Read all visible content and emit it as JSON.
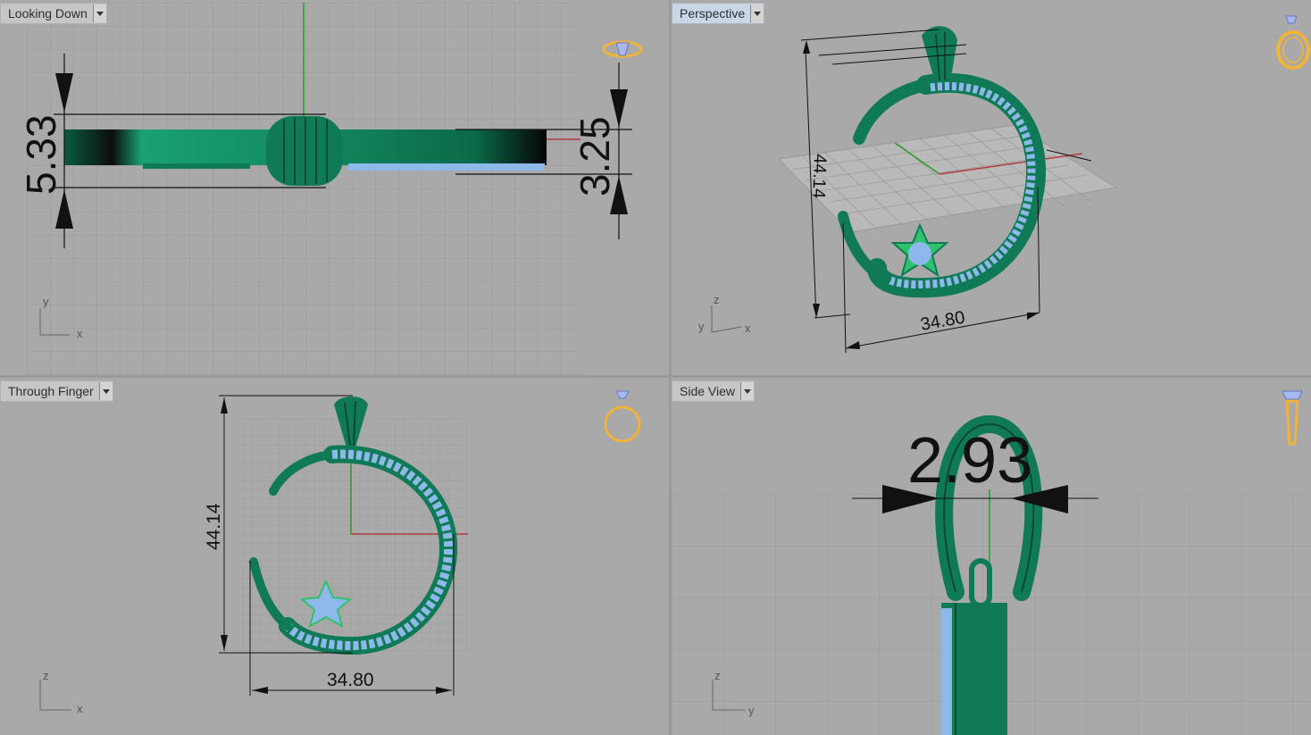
{
  "viewports": {
    "top_left": {
      "title": "Looking Down",
      "dims": [
        "5.33",
        "3.25"
      ],
      "axes": [
        "y",
        "x"
      ]
    },
    "top_right": {
      "title": "Perspective",
      "dims": [
        "44.14",
        "34.80"
      ],
      "axes": [
        "z",
        "y",
        "x"
      ]
    },
    "bottom_left": {
      "title": "Through Finger",
      "dims": [
        "44.14",
        "34.80"
      ],
      "axes": [
        "z",
        "x"
      ]
    },
    "bottom_right": {
      "title": "Side View",
      "dims": [
        "2.93"
      ],
      "axes": [
        "z",
        "y"
      ]
    }
  },
  "colors": {
    "model": "#0f7a55",
    "stones": "#8fb8ea",
    "dim_lines": "#111111",
    "viewport_bg": "#a9a9a9",
    "grid": "#9b9b9b",
    "ring_icon": "#f0b43a",
    "x_axis": "#b43a3a",
    "y_axis": "#2f9a2f"
  },
  "icons": [
    "ring-top-view-icon",
    "ring-perspective-icon",
    "ring-front-view-icon",
    "ring-side-view-icon"
  ]
}
